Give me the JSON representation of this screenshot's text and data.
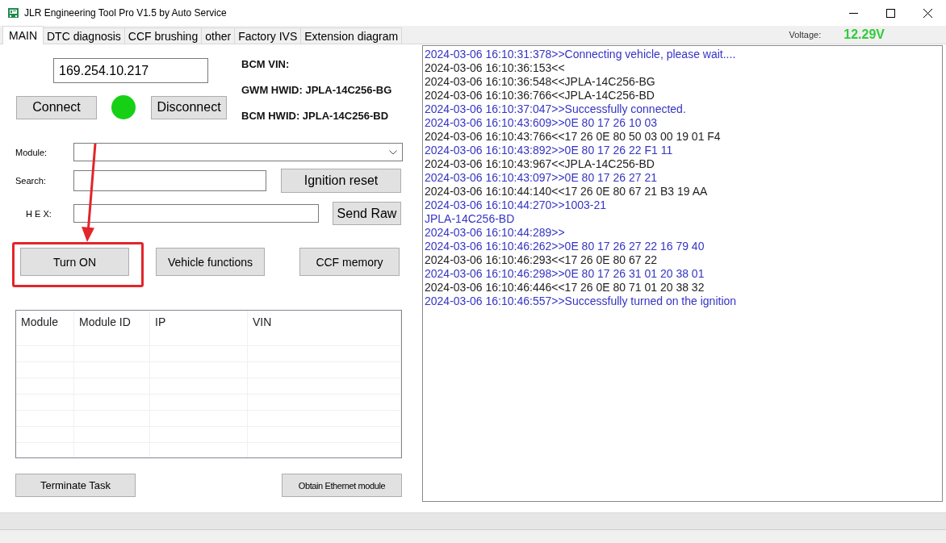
{
  "window": {
    "title": "JLR Engineering Tool Pro V1.5 by Auto Service"
  },
  "tabs": [
    {
      "label": "MAIN",
      "selected": true
    },
    {
      "label": "DTC diagnosis",
      "selected": false
    },
    {
      "label": "CCF brushing",
      "selected": false
    },
    {
      "label": "other",
      "selected": false
    },
    {
      "label": "Factory IVS",
      "selected": false
    },
    {
      "label": "Extension diagram",
      "selected": false
    }
  ],
  "voltage": {
    "label": "Voltage:",
    "value": "12.29V"
  },
  "connection": {
    "ip": "169.254.10.217",
    "connected": true,
    "connect_button": "Connect",
    "disconnect_button": "Disconnect"
  },
  "vehicle_info": [
    "BCM VIN:",
    "GWM HWID: JPLA-14C256-BG",
    "BCM HWID: JPLA-14C256-BD"
  ],
  "fields": [
    {
      "kind": "dropdown",
      "label": "Module:"
    },
    {
      "kind": "text",
      "label": "Search:",
      "button": "Ignition reset"
    },
    {
      "kind": "text",
      "label": "H E X:",
      "button": "Send Raw"
    }
  ],
  "actions": [
    {
      "label": "Turn ON",
      "highlighted": true
    },
    {
      "label": "Vehicle functions",
      "highlighted": false
    },
    {
      "label": "CCF memory",
      "highlighted": false
    }
  ],
  "module_table": {
    "columns": [
      "Module",
      "Module ID",
      "IP",
      "VIN"
    ]
  },
  "footer_buttons": [
    "Terminate Task",
    "Obtain Ethernet module"
  ],
  "log": [
    {
      "kind": "sent",
      "text": "2024-03-06 16:10:31:378>>Connecting vehicle, please wait...."
    },
    {
      "kind": "received",
      "text": "2024-03-06 16:10:36:153<<"
    },
    {
      "kind": "received",
      "text": "2024-03-06 16:10:36:548<<JPLA-14C256-BG"
    },
    {
      "kind": "received",
      "text": "2024-03-06 16:10:36:766<<JPLA-14C256-BD"
    },
    {
      "kind": "sent",
      "text": "2024-03-06 16:10:37:047>>Successfully connected."
    },
    {
      "kind": "sent",
      "text": "2024-03-06 16:10:43:609>>0E 80 17 26 10 03"
    },
    {
      "kind": "received",
      "text": "2024-03-06 16:10:43:766<<17 26 0E 80 50 03 00 19 01 F4"
    },
    {
      "kind": "sent",
      "text": "2024-03-06 16:10:43:892>>0E 80 17 26 22 F1 11"
    },
    {
      "kind": "received",
      "text": "2024-03-06 16:10:43:967<<JPLA-14C256-BD"
    },
    {
      "kind": "sent",
      "text": "2024-03-06 16:10:43:097>>0E 80 17 26 27 21"
    },
    {
      "kind": "received",
      "text": "2024-03-06 16:10:44:140<<17 26 0E 80 67 21 B3 19 AA"
    },
    {
      "kind": "sent",
      "text": "2024-03-06 16:10:44:270>>1003-21"
    },
    {
      "kind": "sent",
      "text": "JPLA-14C256-BD"
    },
    {
      "kind": "sent",
      "text": "2024-03-06 16:10:44:289>>"
    },
    {
      "kind": "sent",
      "text": "2024-03-06 16:10:46:262>>0E 80 17 26 27 22 16 79 40"
    },
    {
      "kind": "received",
      "text": "2024-03-06 16:10:46:293<<17 26 0E 80 67 22"
    },
    {
      "kind": "sent",
      "text": "2024-03-06 16:10:46:298>>0E 80 17 26 31 01 20 38 01"
    },
    {
      "kind": "received",
      "text": "2024-03-06 16:10:46:446<<17 26 0E 80 71 01 20 38 32"
    },
    {
      "kind": "sent",
      "text": "2024-03-06 16:10:46:557>>Successfully turned on the ignition"
    }
  ]
}
